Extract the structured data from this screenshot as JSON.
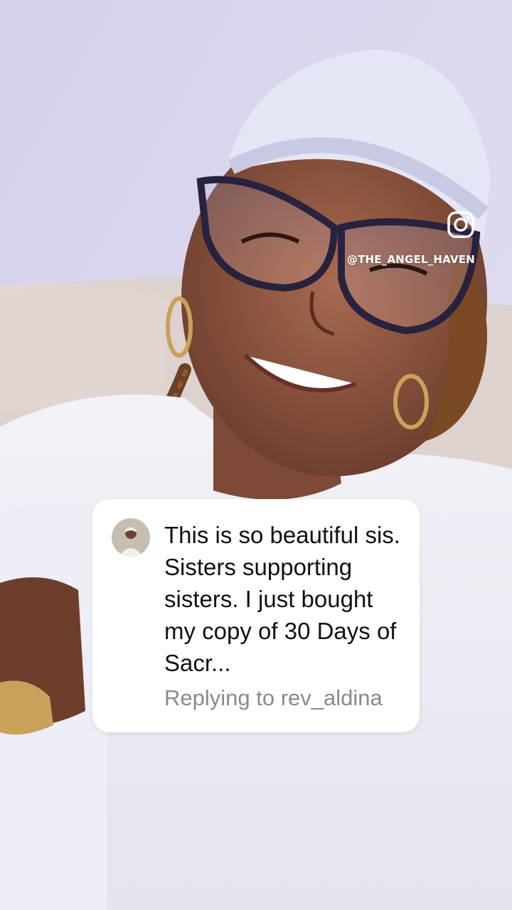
{
  "brand": {
    "icon": "instagram-icon",
    "handle": "@THE_ANGEL_HAVEN"
  },
  "reply_card": {
    "avatar_icon": "commenter-avatar",
    "comment": "This is so beautiful sis. Sisters supporting sisters. I just bought my copy of 30 Days of Sacr...",
    "replying_to": "Replying to rev_aldina"
  },
  "colors": {
    "card_bg": "#ffffff",
    "muted_text": "#8a8a8a",
    "overlay_text": "#ffffff"
  }
}
